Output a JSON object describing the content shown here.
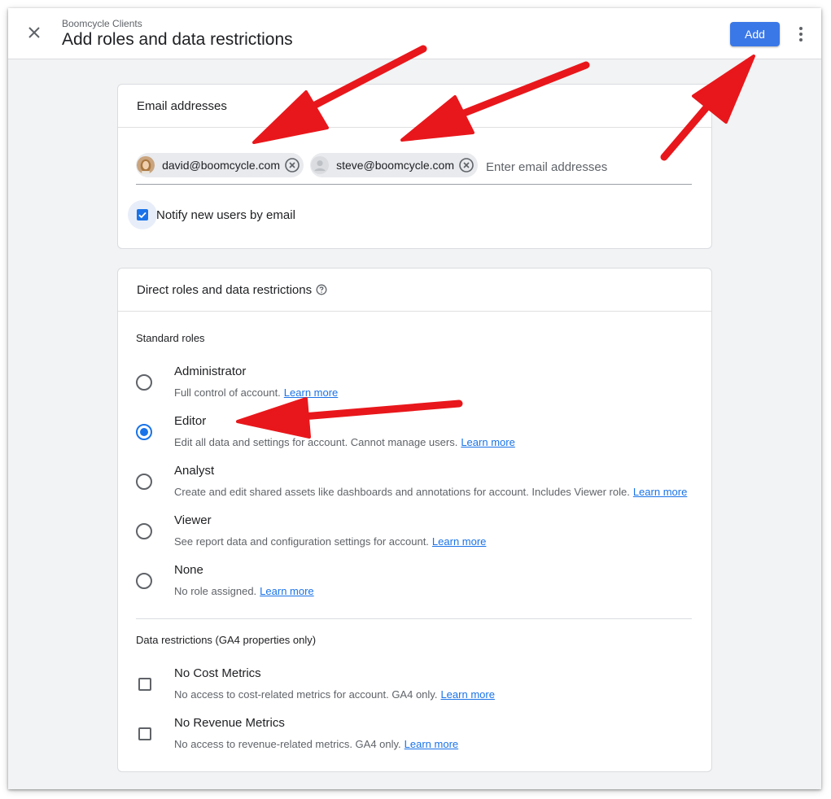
{
  "header": {
    "breadcrumb": "Boomcycle Clients",
    "title": "Add roles and data restrictions",
    "add_label": "Add"
  },
  "email_card": {
    "heading": "Email addresses",
    "chips": [
      {
        "email": "david@boomcycle.com",
        "avatar": "photo-avatar"
      },
      {
        "email": "steve@boomcycle.com",
        "avatar": "default-person-avatar"
      }
    ],
    "input_placeholder": "Enter email addresses",
    "notify_label": "Notify new users by email",
    "notify_checked": true
  },
  "roles_card": {
    "heading": "Direct roles and data restrictions",
    "standard_roles_label": "Standard roles",
    "roles": [
      {
        "name": "Administrator",
        "desc": "Full control of account.",
        "link": "Learn more",
        "selected": false
      },
      {
        "name": "Editor",
        "desc": "Edit all data and settings for account. Cannot manage users.",
        "link": "Learn more",
        "selected": true
      },
      {
        "name": "Analyst",
        "desc": "Create and edit shared assets like dashboards and annotations for account. Includes Viewer role.",
        "link": "Learn more",
        "selected": false
      },
      {
        "name": "Viewer",
        "desc": "See report data and configuration settings for account.",
        "link": "Learn more",
        "selected": false
      },
      {
        "name": "None",
        "desc": "No role assigned.",
        "link": "Learn more",
        "selected": false
      }
    ],
    "restrictions_label": "Data restrictions (GA4 properties only)",
    "restrictions": [
      {
        "name": "No Cost Metrics",
        "desc": "No access to cost-related metrics for account. GA4 only.",
        "link": "Learn more",
        "checked": false
      },
      {
        "name": "No Revenue Metrics",
        "desc": "No access to revenue-related metrics. GA4 only.",
        "link": "Learn more",
        "checked": false
      }
    ]
  },
  "colors": {
    "accent": "#1a73e8",
    "button": "#3b78e7",
    "annotation_arrow": "#e8171b"
  }
}
